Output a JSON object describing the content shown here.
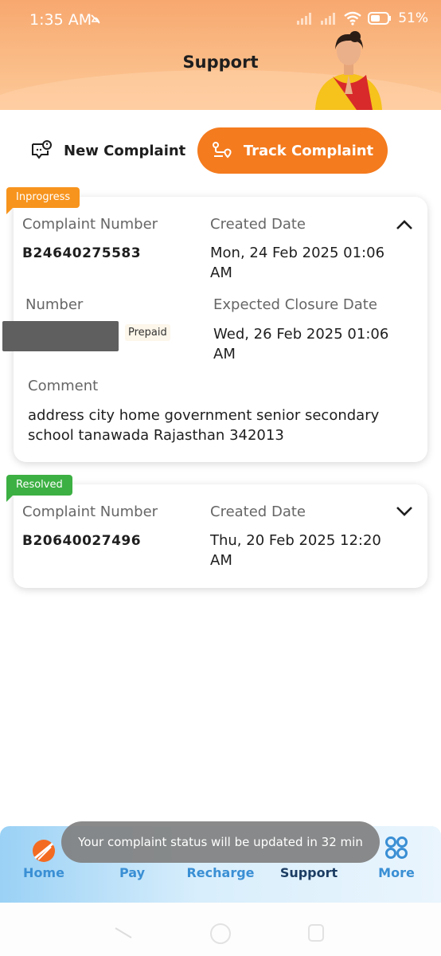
{
  "status_bar": {
    "time": "1:35 AM",
    "battery": "51%"
  },
  "header": {
    "title": "Support"
  },
  "tabs": {
    "new_complaint": "New Complaint",
    "track_complaint": "Track Complaint"
  },
  "complaints": [
    {
      "status": "Inprogress",
      "status_color": "#f7941d",
      "complaint_number_label": "Complaint Number",
      "complaint_number": "B24640275583",
      "created_date_label": "Created Date",
      "created_date": "Mon, 24 Feb 2025 01:06 AM",
      "number_label": "Number",
      "number_type": "Prepaid",
      "expected_closure_label": "Expected Closure Date",
      "expected_closure": "Wed, 26 Feb 2025 01:06 AM",
      "comment_label": "Comment",
      "comment": "address city home government senior secondary school tanawada Rajasthan 342013",
      "expanded": true
    },
    {
      "status": "Resolved",
      "status_color": "#3cb043",
      "complaint_number_label": "Complaint Number",
      "complaint_number": "B20640027496",
      "created_date_label": "Created Date",
      "created_date": "Thu, 20 Feb 2025 12:20 AM",
      "expanded": false
    }
  ],
  "bottom_nav": {
    "items": [
      {
        "label": "Home",
        "icon": "home-logo-icon"
      },
      {
        "label": "Pay",
        "icon": "pay-icon"
      },
      {
        "label": "Recharge",
        "icon": "recharge-icon"
      },
      {
        "label": "Support",
        "icon": "support-icon",
        "active": true
      },
      {
        "label": "More",
        "icon": "more-grid-icon"
      }
    ]
  },
  "toast": {
    "message": "Your complaint status will be updated in 32 min"
  },
  "colors": {
    "accent": "#f47b1e",
    "in_progress": "#f7941d",
    "resolved": "#3cb043",
    "nav_text": "#3a8fd4"
  }
}
